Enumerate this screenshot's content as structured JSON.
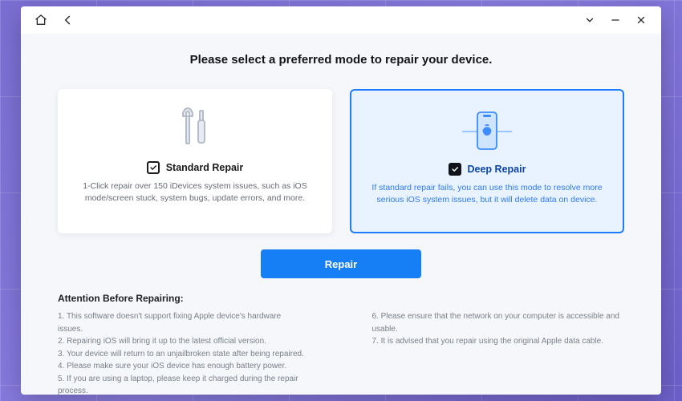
{
  "header": {
    "title": "Please select a preferred mode to repair your device."
  },
  "modes": {
    "standard": {
      "name": "Standard Repair",
      "desc": "1-Click repair over 150 iDevices system issues, such as iOS mode/screen stuck, system bugs, update errors, and more."
    },
    "deep": {
      "name": "Deep Repair",
      "desc": "If standard repair fails, you can use this mode to resolve more serious iOS system issues, but it will delete data on device."
    }
  },
  "actions": {
    "repair_label": "Repair"
  },
  "attention": {
    "heading": "Attention Before Repairing:",
    "tips_left": [
      "1. This software doesn't support fixing Apple device's hardware issues.",
      "2. Repairing iOS will bring it up to the latest official version.",
      "3. Your device will return to an unjailbroken state after being repaired.",
      "4. Please make sure your iOS device has enough battery power.",
      "5. If you are using a laptop, please keep it charged during the repair process."
    ],
    "tips_right": [
      "6. Please ensure that the network on your computer is accessible and usable.",
      "7. It is advised that you repair using the original Apple data cable."
    ]
  }
}
